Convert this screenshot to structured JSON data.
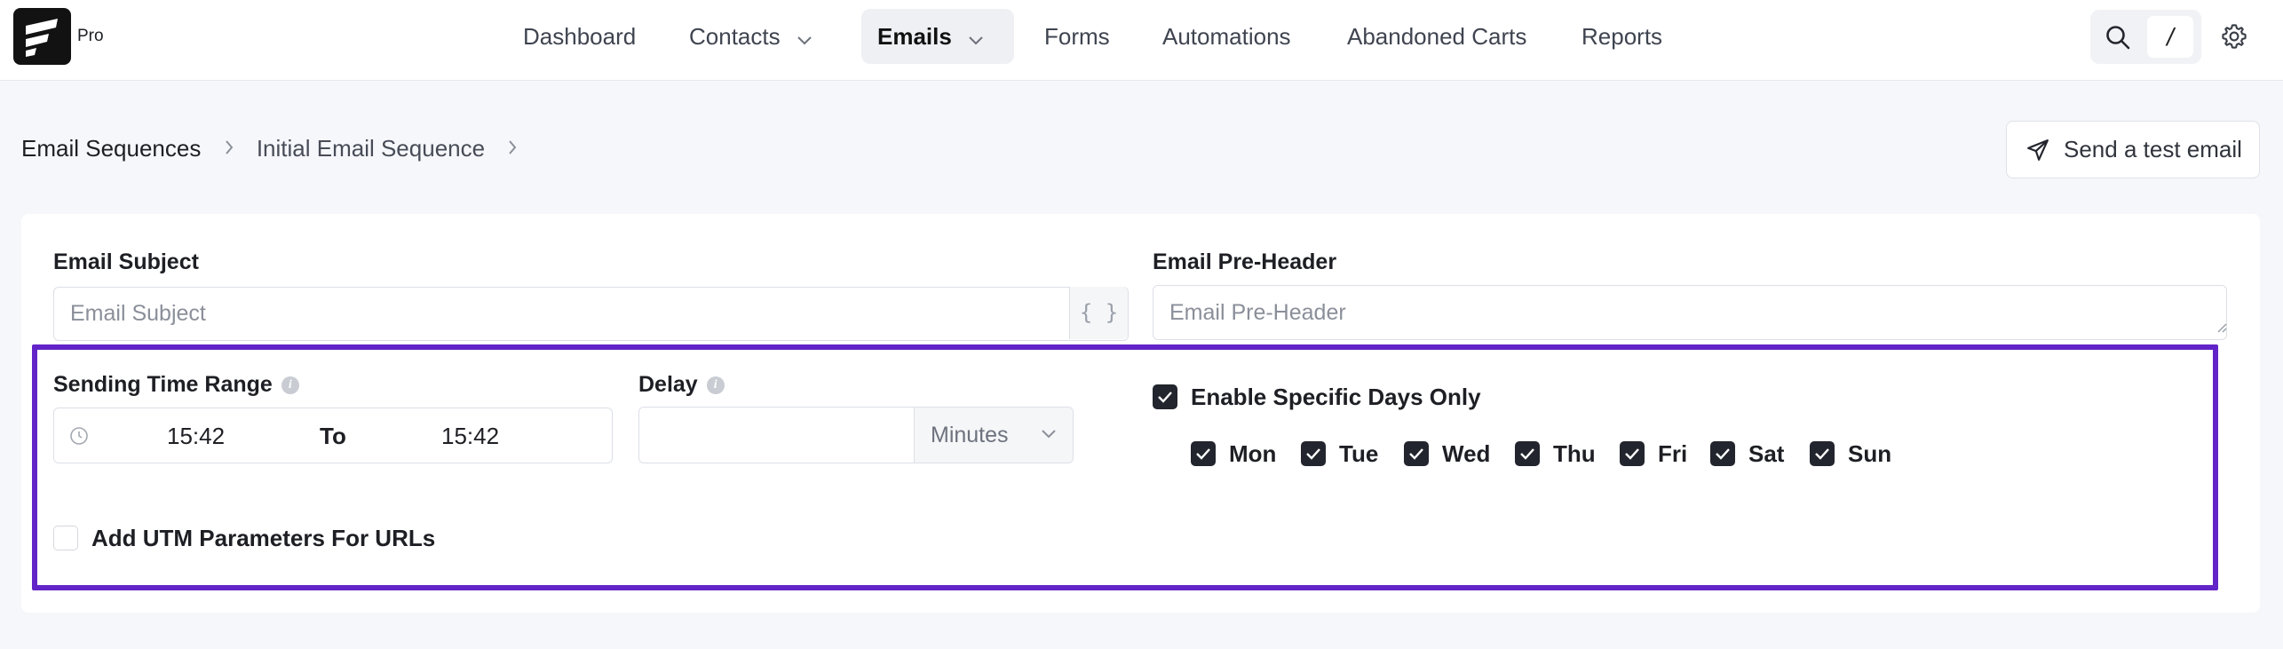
{
  "brand": {
    "tier": "Pro"
  },
  "nav": {
    "items": [
      {
        "label": "Dashboard"
      },
      {
        "label": "Contacts"
      },
      {
        "label": "Emails"
      },
      {
        "label": "Forms"
      },
      {
        "label": "Automations"
      },
      {
        "label": "Abandoned Carts"
      },
      {
        "label": "Reports"
      }
    ],
    "search_shortcut": "/"
  },
  "breadcrumb": {
    "root": "Email Sequences",
    "current": "Initial Email Sequence"
  },
  "actions": {
    "send_test_email": "Send a test email"
  },
  "form": {
    "subject": {
      "label": "Email Subject",
      "placeholder": "Email Subject",
      "merge_tag": "{ }"
    },
    "preheader": {
      "label": "Email Pre-Header",
      "placeholder": "Email Pre-Header"
    },
    "sending_time_range": {
      "label": "Sending Time Range",
      "start": "15:42",
      "separator": "To",
      "end": "15:42"
    },
    "delay": {
      "label": "Delay",
      "value": "",
      "unit": "Minutes"
    },
    "specific_days": {
      "label": "Enable Specific Days Only",
      "enabled": true,
      "days": [
        {
          "label": "Mon",
          "checked": true
        },
        {
          "label": "Tue",
          "checked": true
        },
        {
          "label": "Wed",
          "checked": true
        },
        {
          "label": "Thu",
          "checked": true
        },
        {
          "label": "Fri",
          "checked": true
        },
        {
          "label": "Sat",
          "checked": true
        },
        {
          "label": "Sun",
          "checked": true
        }
      ]
    },
    "utm": {
      "label": "Add UTM Parameters For URLs",
      "checked": false
    }
  },
  "colors": {
    "highlight": "#6224c8",
    "checkbox": "#22252d",
    "active_nav_bg": "#eef0f4"
  },
  "icons": [
    "logo-icon",
    "chevron-down-icon",
    "search-icon",
    "gear-icon",
    "chevron-right-icon",
    "send-icon",
    "info-icon",
    "clock-icon",
    "check-icon"
  ]
}
